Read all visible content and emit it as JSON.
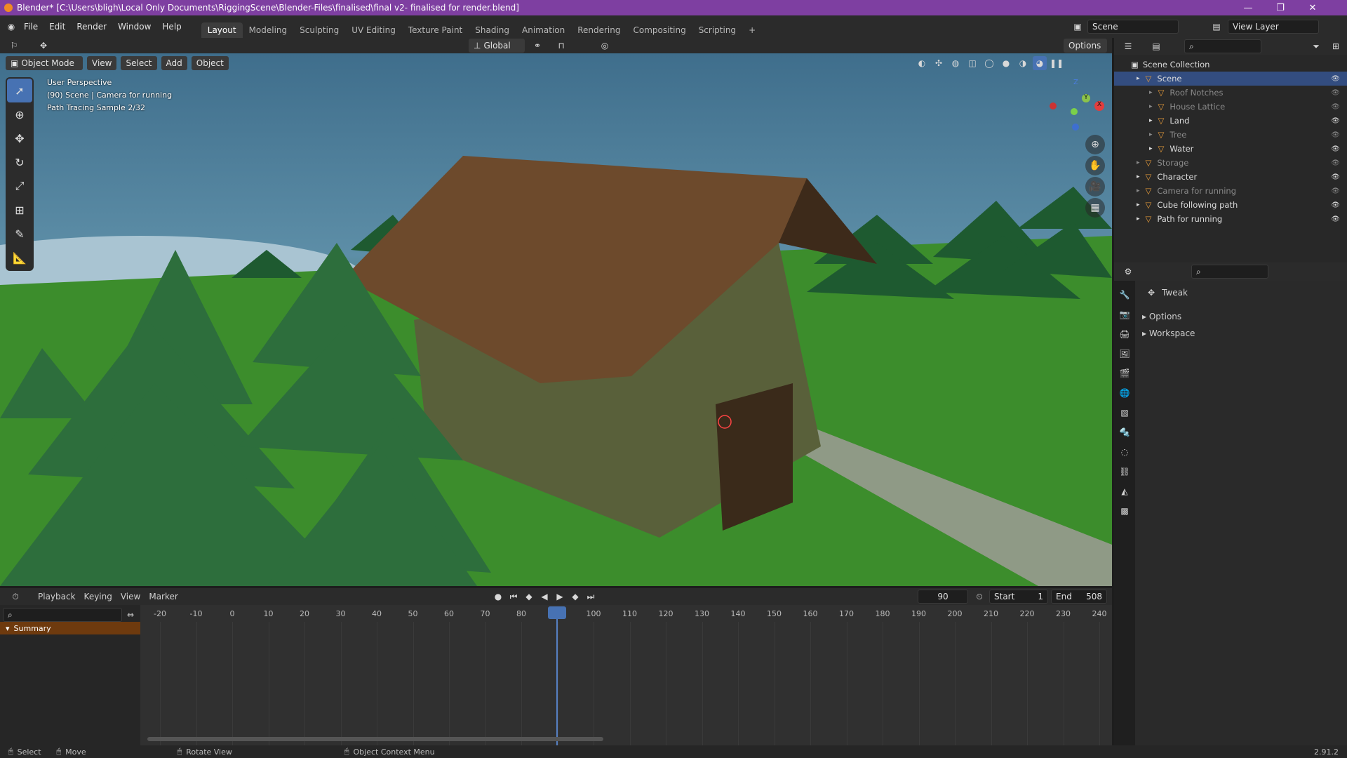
{
  "titlebar": {
    "title": "Blender* [C:\\Users\\bligh\\Local Only Documents\\RiggingScene\\Blender-Files\\finalised\\final v2-  finalised for render.blend]",
    "min": "—",
    "max": "❐",
    "close": "✕"
  },
  "menu": {
    "items": [
      "File",
      "Edit",
      "Render",
      "Window",
      "Help"
    ]
  },
  "workspaces": [
    "Layout",
    "Modeling",
    "Sculpting",
    "UV Editing",
    "Texture Paint",
    "Shading",
    "Animation",
    "Rendering",
    "Compositing",
    "Scripting"
  ],
  "workspace_add": "+",
  "scene_field": "Scene",
  "view_layer_field": "View Layer",
  "header2": {
    "orientation": "Global",
    "options": "Options"
  },
  "viewport": {
    "mode": "Object Mode",
    "menus": [
      "View",
      "Select",
      "Add",
      "Object"
    ],
    "overlay_lines": [
      "User Perspective",
      "(90) Scene | Camera for running",
      "Path Tracing Sample 2/32"
    ],
    "gizmo": {
      "z": "Z",
      "y": "Y",
      "x": "X"
    }
  },
  "outliner": {
    "root": "Scene Collection",
    "rows": [
      {
        "label": "Scene",
        "indent": 1,
        "selected": true
      },
      {
        "label": "Roof Notches",
        "indent": 2,
        "dim": true
      },
      {
        "label": "House Lattice",
        "indent": 2,
        "dim": true
      },
      {
        "label": "Land",
        "indent": 2
      },
      {
        "label": "Tree",
        "indent": 2,
        "dim": true
      },
      {
        "label": "Water",
        "indent": 2
      },
      {
        "label": "Storage",
        "indent": 1,
        "dim": true
      },
      {
        "label": "Character",
        "indent": 1
      },
      {
        "label": "Camera for running",
        "indent": 1,
        "dim": true
      },
      {
        "label": "Cube following path",
        "indent": 1
      },
      {
        "label": "Path for running",
        "indent": 1
      }
    ]
  },
  "properties": {
    "tool": "Tweak",
    "sections": [
      "Options",
      "Workspace"
    ]
  },
  "timeline": {
    "menus": [
      "Playback",
      "Keying",
      "View",
      "Marker"
    ],
    "current_frame": "90",
    "start_label": "Start",
    "start": "1",
    "end_label": "End",
    "end": "508",
    "ticks": [
      "-20",
      "-10",
      "0",
      "10",
      "20",
      "30",
      "40",
      "50",
      "60",
      "70",
      "80",
      "90",
      "100",
      "110",
      "120",
      "130",
      "140",
      "150",
      "160",
      "170",
      "180",
      "190",
      "200",
      "210",
      "220",
      "230",
      "240"
    ],
    "summary": "Summary"
  },
  "status": {
    "select": "Select",
    "move": "Move",
    "rotate": "Rotate View",
    "context": "Object Context Menu",
    "version": "2.91.2"
  },
  "colors": {
    "title_purple": "#7e3fa1",
    "selection_blue": "#4772b3",
    "summary_orange": "#6e3a0e"
  }
}
